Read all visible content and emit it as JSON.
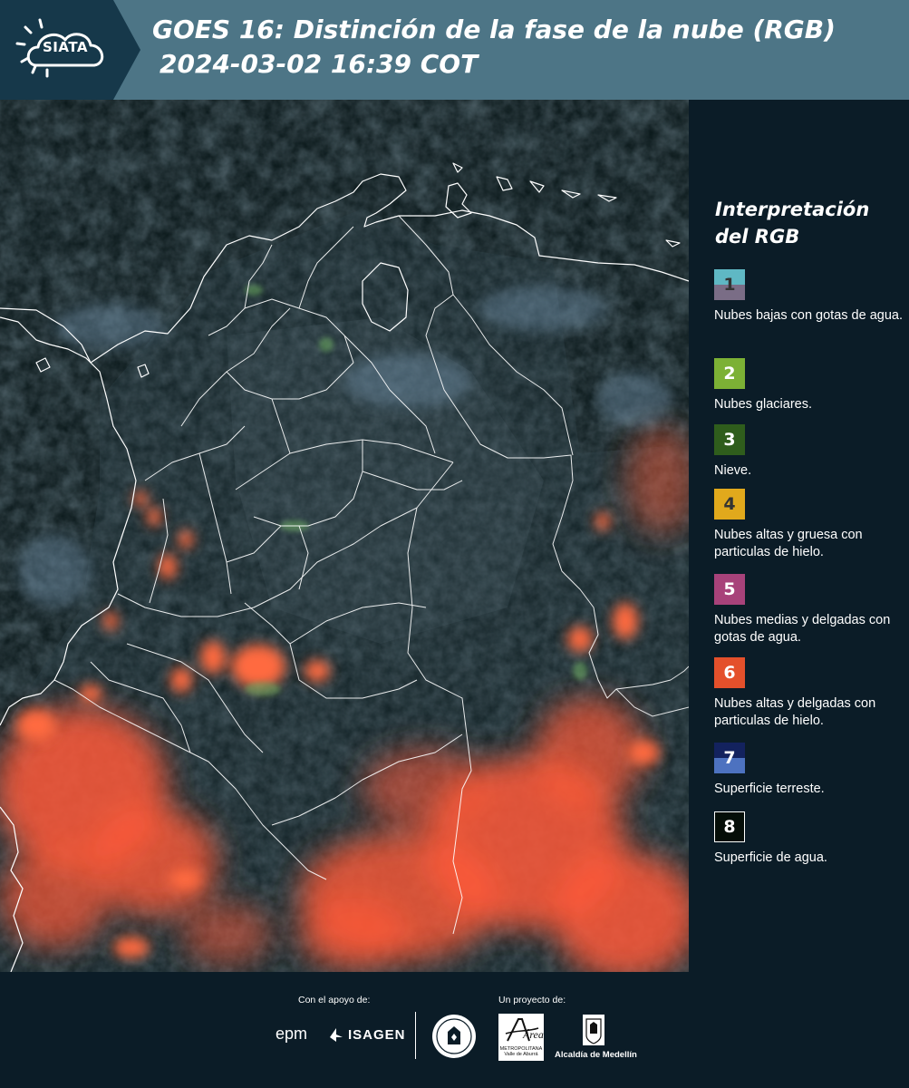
{
  "header": {
    "logo_text": "SIATA",
    "title_line1": "GOES 16: Distinción de la fase de la nube (RGB)",
    "title_line2": "2024-03-02 16:39 COT"
  },
  "legend": {
    "title": "Interpretación del RGB",
    "items": [
      {
        "number": "1",
        "label": "Nubes bajas con gotas de agua.",
        "color_top": "#5fb8c4",
        "color_bottom": "#7a6d86"
      },
      {
        "number": "2",
        "label": "Nubes glaciares.",
        "color_top": "#7cb135",
        "color_bottom": "#7cb135"
      },
      {
        "number": "3",
        "label": "Nieve.",
        "color_top": "#2f5d1c",
        "color_bottom": "#2f5d1c"
      },
      {
        "number": "4",
        "label": "Nubes altas y gruesa con particulas de hielo.",
        "color_top": "#e1a91c",
        "color_bottom": "#e1a91c"
      },
      {
        "number": "5",
        "label": "Nubes medias y delgadas con gotas de agua.",
        "color_top": "#a8427a",
        "color_bottom": "#a8427a"
      },
      {
        "number": "6",
        "label": "Nubes altas y delgadas con particulas de hielo.",
        "color_top": "#e4502b",
        "color_bottom": "#e4502b"
      },
      {
        "number": "7",
        "label": "Superficie terreste.",
        "color_top": "#13225e",
        "color_bottom": "#4d72c0"
      },
      {
        "number": "8",
        "label": "Superficie de agua.",
        "color_top": "#050e08",
        "color_bottom": "#050e08"
      }
    ]
  },
  "footer": {
    "sponsor_caption": "Con el apoyo de:",
    "project_caption": "Un proyecto de:",
    "sponsor_1": "epm",
    "sponsor_2": "ISAGEN",
    "partner_amva": "Área",
    "partner_amva_sub": "METROPOLITANA Valle de Aburrá",
    "partner_alcaldia": "Alcaldía de Medellín"
  },
  "colors": {
    "header_bg": "#4d7586",
    "logo_bg": "#16384a",
    "page_bg": "#0b1c27",
    "cloud_red": "#ff5a38",
    "boundary": "#ffffff"
  },
  "map": {
    "icon": "satellite-rgb-image"
  }
}
